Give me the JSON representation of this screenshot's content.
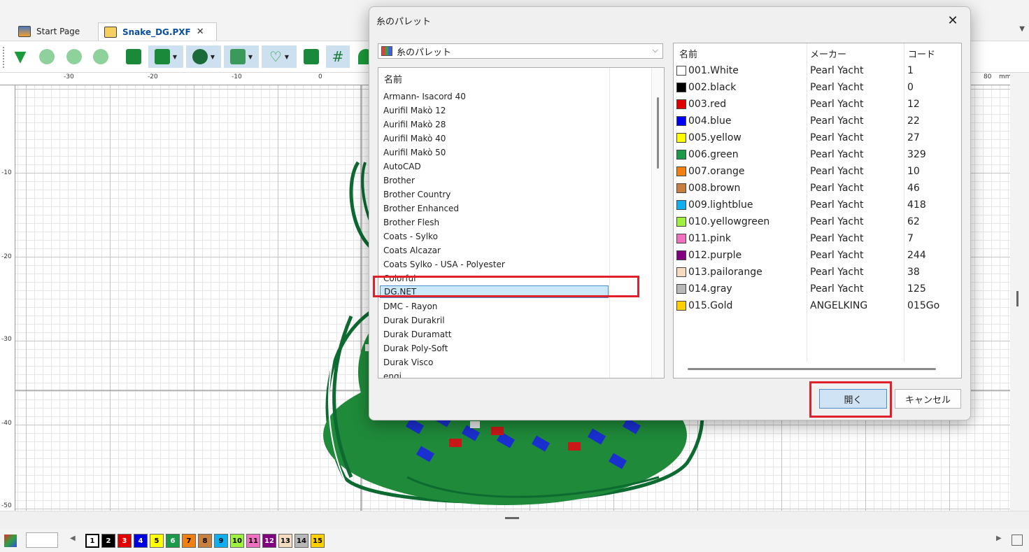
{
  "tabs": [
    {
      "label": "Start Page"
    },
    {
      "label": "Snake_DG.PXF"
    }
  ],
  "ruler": {
    "h_labels": [
      "-30",
      "-20",
      "-10",
      "0",
      "80",
      "mm"
    ],
    "v_labels": [
      "-10",
      "-20",
      "-30",
      "-40",
      "-50"
    ]
  },
  "swatches": [
    {
      "label": "1",
      "color": "#ffffff",
      "text": "#000000"
    },
    {
      "label": "2",
      "color": "#000000",
      "text": "#ffffff"
    },
    {
      "label": "3",
      "color": "#e00000",
      "text": "#ffffff"
    },
    {
      "label": "4",
      "color": "#0000e0",
      "text": "#ffffff"
    },
    {
      "label": "5",
      "color": "#ffff00",
      "text": "#000000"
    },
    {
      "label": "6",
      "color": "#1a9a4a",
      "text": "#ffffff"
    },
    {
      "label": "7",
      "color": "#f08010",
      "text": "#000000"
    },
    {
      "label": "8",
      "color": "#c88040",
      "text": "#000000"
    },
    {
      "label": "9",
      "color": "#10b0f0",
      "text": "#000000"
    },
    {
      "label": "10",
      "color": "#a0f040",
      "text": "#000000"
    },
    {
      "label": "11",
      "color": "#f070c0",
      "text": "#000000"
    },
    {
      "label": "12",
      "color": "#800080",
      "text": "#ffffff"
    },
    {
      "label": "13",
      "color": "#f5dcc0",
      "text": "#000000"
    },
    {
      "label": "14",
      "color": "#b8b8b8",
      "text": "#000000"
    },
    {
      "label": "15",
      "color": "#ffd000",
      "text": "#000000"
    }
  ],
  "dialog": {
    "title": "糸のパレット",
    "combo_value": "糸のパレット",
    "list_header": "名前",
    "list_items": [
      "Armann- Isacord 40",
      "Aurifil Makò 12",
      "Aurifil Makò 28",
      "Aurifil Makò 40",
      "Aurifil Makò 50",
      "AutoCAD",
      "Brother",
      "Brother Country",
      "Brother Enhanced",
      "Brother Flesh",
      "Coats - Sylko",
      "Coats Alcazar",
      "Coats Sylko - USA - Polyester",
      "Colorful",
      "DG.NET",
      "DMC - Rayon",
      "Durak Durakril",
      "Durak Duramatt",
      "Durak Poly-Soft",
      "Durak Visco",
      "engi"
    ],
    "table_headers": {
      "name": "名前",
      "maker": "メーカー",
      "code": "コード"
    },
    "threads": [
      {
        "name": "001.White",
        "maker": "Pearl Yacht",
        "code": "1",
        "color": "#ffffff"
      },
      {
        "name": "002.black",
        "maker": "Pearl Yacht",
        "code": "0",
        "color": "#000000"
      },
      {
        "name": "003.red",
        "maker": "Pearl Yacht",
        "code": "12",
        "color": "#e00000"
      },
      {
        "name": "004.blue",
        "maker": "Pearl Yacht",
        "code": "22",
        "color": "#0000f0"
      },
      {
        "name": "005.yellow",
        "maker": "Pearl Yacht",
        "code": "27",
        "color": "#ffff00"
      },
      {
        "name": "006.green",
        "maker": "Pearl Yacht",
        "code": "329",
        "color": "#1a9a4a"
      },
      {
        "name": "007.orange",
        "maker": "Pearl Yacht",
        "code": "10",
        "color": "#f08010"
      },
      {
        "name": "008.brown",
        "maker": "Pearl Yacht",
        "code": "46",
        "color": "#c88040"
      },
      {
        "name": "009.lightblue",
        "maker": "Pearl Yacht",
        "code": "418",
        "color": "#10b0f0"
      },
      {
        "name": "010.yellowgreen",
        "maker": "Pearl Yacht",
        "code": "62",
        "color": "#a0f040"
      },
      {
        "name": "011.pink",
        "maker": "Pearl Yacht",
        "code": "7",
        "color": "#f070c0"
      },
      {
        "name": "012.purple",
        "maker": "Pearl Yacht",
        "code": "244",
        "color": "#800080"
      },
      {
        "name": "013.pailorange",
        "maker": "Pearl Yacht",
        "code": "38",
        "color": "#f5dcc0"
      },
      {
        "name": "014.gray",
        "maker": "Pearl Yacht",
        "code": "125",
        "color": "#b8b8b8"
      },
      {
        "name": "015.Gold",
        "maker": "ANGELKING",
        "code": "015Go",
        "color": "#ffd000"
      }
    ],
    "open_label": "開く",
    "cancel_label": "キャンセル"
  }
}
